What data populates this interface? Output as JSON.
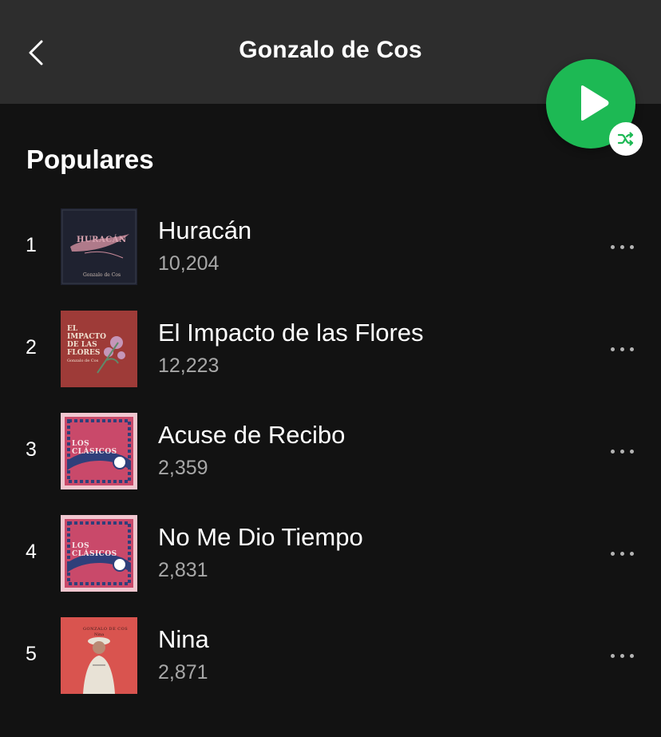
{
  "header": {
    "title": "Gonzalo de Cos"
  },
  "section": {
    "title": "Populares"
  },
  "tracks": [
    {
      "number": "1",
      "name": "Huracán",
      "plays": "10,204",
      "cover": {
        "title": "HURACÁN",
        "artist": "Gonzalo de Cos",
        "bg": "#1f2230"
      }
    },
    {
      "number": "2",
      "name": "El Impacto de las Flores",
      "plays": "12,223",
      "cover": {
        "title": "EL IMPACTO DE LAS FLORES",
        "artist": "Gonzalo de Cos",
        "bg": "#9e3b38"
      }
    },
    {
      "number": "3",
      "name": "Acuse de Recibo",
      "plays": "2,359",
      "cover": {
        "title": "LOS CLÁSICOS",
        "bg": "#c9496a"
      }
    },
    {
      "number": "4",
      "name": "No Me Dio Tiempo",
      "plays": "2,831",
      "cover": {
        "title": "LOS CLÁSICOS",
        "bg": "#c9496a"
      }
    },
    {
      "number": "5",
      "name": "Nina",
      "plays": "2,871",
      "cover": {
        "title": "GONZALO DE COS",
        "subtitle": "Nina",
        "bg": "#d9544f"
      }
    }
  ],
  "colors": {
    "accent": "#1db954",
    "header_bg": "#2d2d2d",
    "page_bg": "#121212",
    "secondary_text": "#a7a7a7"
  },
  "icons": {
    "back": "chevron-left-icon",
    "play": "play-icon",
    "shuffle": "shuffle-icon",
    "more": "more-dots-icon"
  }
}
